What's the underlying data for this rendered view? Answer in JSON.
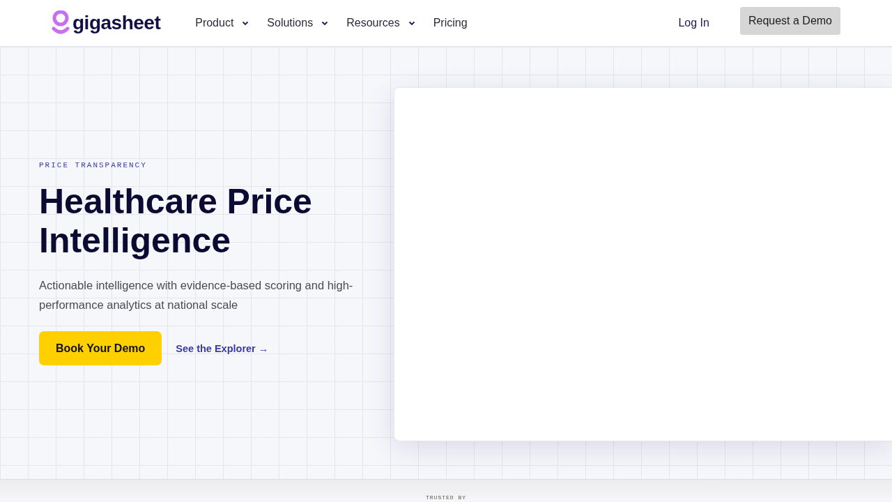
{
  "header": {
    "logo": "gigasheet",
    "nav": [
      {
        "label": "Product",
        "dropdown": true
      },
      {
        "label": "Solutions",
        "dropdown": true
      },
      {
        "label": "Resources",
        "dropdown": true
      },
      {
        "label": "Pricing",
        "dropdown": false
      }
    ],
    "login": "Log In",
    "cta": "Request a Demo"
  },
  "hero": {
    "eyebrow": "PRICE TRANSPARENCY",
    "title": "Healthcare Price Intelligence",
    "subtitle": "Actionable intelligence with evidence-based scoring and high-performance analytics at national scale",
    "primary_button": "Book Your Demo",
    "link": "See the Explorer →"
  },
  "trusted": {
    "label": "TRUSTED BY"
  }
}
